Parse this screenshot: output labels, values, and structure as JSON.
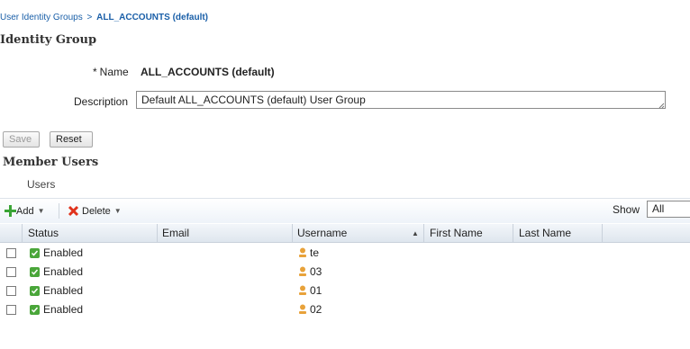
{
  "breadcrumb": {
    "parent": "User Identity Groups",
    "separator": ">",
    "current": "ALL_ACCOUNTS (default)"
  },
  "page_title": "Identity Group",
  "form": {
    "name_required_mark": "*",
    "name_label": "Name",
    "name_value": "ALL_ACCOUNTS (default)",
    "description_label": "Description",
    "description_value": "Default ALL_ACCOUNTS (default) User Group"
  },
  "buttons": {
    "save": "Save",
    "reset": "Reset"
  },
  "member_section_title": "Member Users",
  "users_tab": "Users",
  "toolbar": {
    "add": "Add",
    "delete": "Delete",
    "show_label": "Show",
    "show_value": "All"
  },
  "columns": {
    "status": "Status",
    "email": "Email",
    "username": "Username",
    "first_name": "First Name",
    "last_name": "Last Name"
  },
  "rows": [
    {
      "status": "Enabled",
      "email": "",
      "username": "te",
      "first_name": "",
      "last_name": ""
    },
    {
      "status": "Enabled",
      "email": "",
      "username": "03",
      "first_name": "",
      "last_name": ""
    },
    {
      "status": "Enabled",
      "email": "",
      "username": "01",
      "first_name": "",
      "last_name": ""
    },
    {
      "status": "Enabled",
      "email": "",
      "username": "02",
      "first_name": "",
      "last_name": ""
    }
  ],
  "icons": {
    "add": "plus-icon",
    "delete": "x-icon",
    "status": "check-icon",
    "user": "user-icon",
    "sort": "sort-asc-icon"
  },
  "colors": {
    "link": "#1a5fa8",
    "add_green": "#3aa435",
    "delete_red": "#e0321c",
    "enabled_green": "#4aa63a",
    "user_orange": "#e8a23a"
  }
}
